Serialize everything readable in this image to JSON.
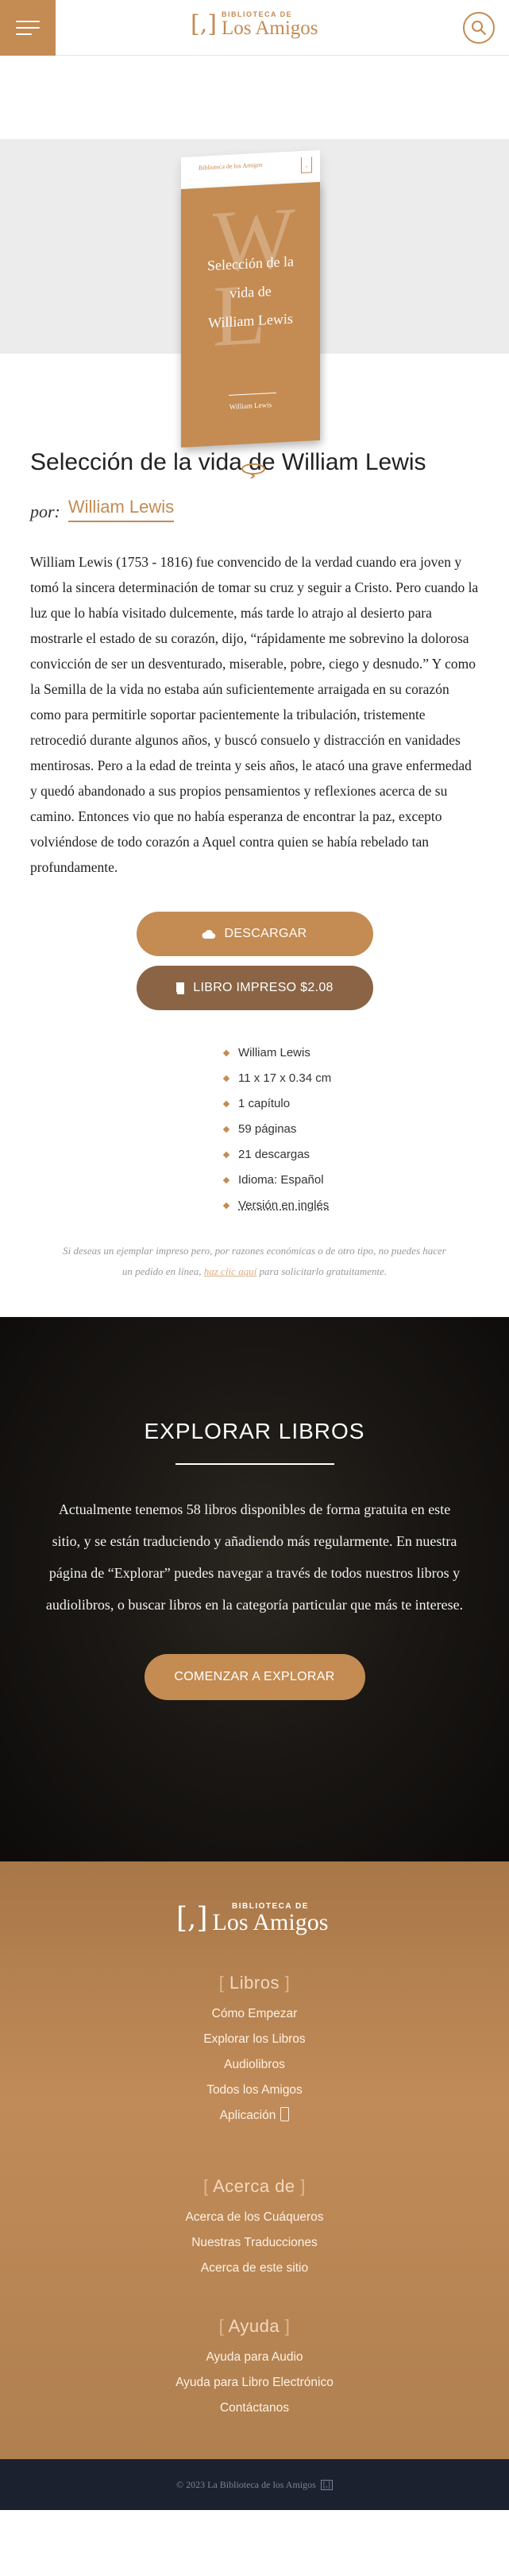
{
  "header": {
    "logo_small": "BIBLIOTECA DE",
    "logo_big": "Los Amigos",
    "logo_mark": "[,]",
    "menu_icon": "hamburger-menu-icon",
    "search_icon": "search-icon"
  },
  "cover": {
    "top_label": "Biblioteca de los Amigos",
    "wl_letters": "W L",
    "title_line1": "Selección de la",
    "title_line2": "vida de",
    "title_line3": "William Lewis",
    "author": "William Lewis",
    "rotate_icon": "rotate-icon"
  },
  "book": {
    "title": "Selección de la vida de William Lewis",
    "by_label": "por:",
    "author": "William Lewis",
    "description": "William Lewis (1753 - 1816) fue convencido de la verdad cuando era joven y tomó la sincera determinación de tomar su cruz y seguir a Cristo. Pero cuando la luz que lo había visitado dulcemente, más tarde lo atrajo al desierto para mostrarle el estado de su corazón, dijo, “rápidamente me sobrevino la dolorosa convicción de ser un desventurado, miserable, pobre, ciego y desnudo.” Y como la Semilla de la vida no estaba aún suficientemente arraigada en su corazón como para permitirle soportar pacientemente la tribulación, tristemente retrocedió durante algunos años, y buscó consuelo y distracción en vanidades mentirosas. Pero a la edad de treinta y seis años, le atacó una grave enfermedad y quedó abandonado a sus propios pensamientos y reflexiones acerca de su camino. Entonces vio que no había esperanza de encontrar la paz, excepto volviéndose de todo corazón a Aquel contra quien se había rebelado tan profundamente.",
    "download_label": "Descargar",
    "print_label": "Libro Impreso $2.08",
    "info": [
      "William Lewis",
      "11 x 17 x 0.34 cm",
      "1 capítulo",
      "59 páginas",
      "21 descargas",
      "Idioma: Español"
    ],
    "english_link": "Versión en inglés",
    "print_note_before": "Si deseas un ejemplar impreso pero, por razones económicas o de otro tipo, no puedes hacer un pedido en línea,",
    "print_note_link": "haz clic aquí",
    "print_note_after": "para solicitarlo gratuitamente."
  },
  "explore": {
    "title": "EXPLORAR LIBROS",
    "text": "Actualmente tenemos 58 libros disponibles de forma gratuita en este sitio, y se están traduciendo y añadiendo más regularmente. En nuestra página de “Explorar” puedes navegar a través de todos nuestros libros y audiolibros, o buscar libros en la categoría particular que más te interese.",
    "button_label": "Comenzar a Explorar"
  },
  "footer": {
    "sections": [
      {
        "heading": "Libros",
        "links": [
          "Cómo Empezar",
          "Explorar los Libros",
          "Audiolibros",
          "Todos los Amigos",
          "Aplicación"
        ]
      },
      {
        "heading": "Acerca de",
        "links": [
          "Acerca de los Cuáqueros",
          "Nuestras Traducciones",
          "Acerca de este sitio"
        ]
      },
      {
        "heading": "Ayuda",
        "links": [
          "Ayuda para Audio",
          "Ayuda para Libro Electrónico",
          "Contáctanos"
        ]
      }
    ],
    "copyright": "© 2023 La Biblioteca de los Amigos"
  }
}
